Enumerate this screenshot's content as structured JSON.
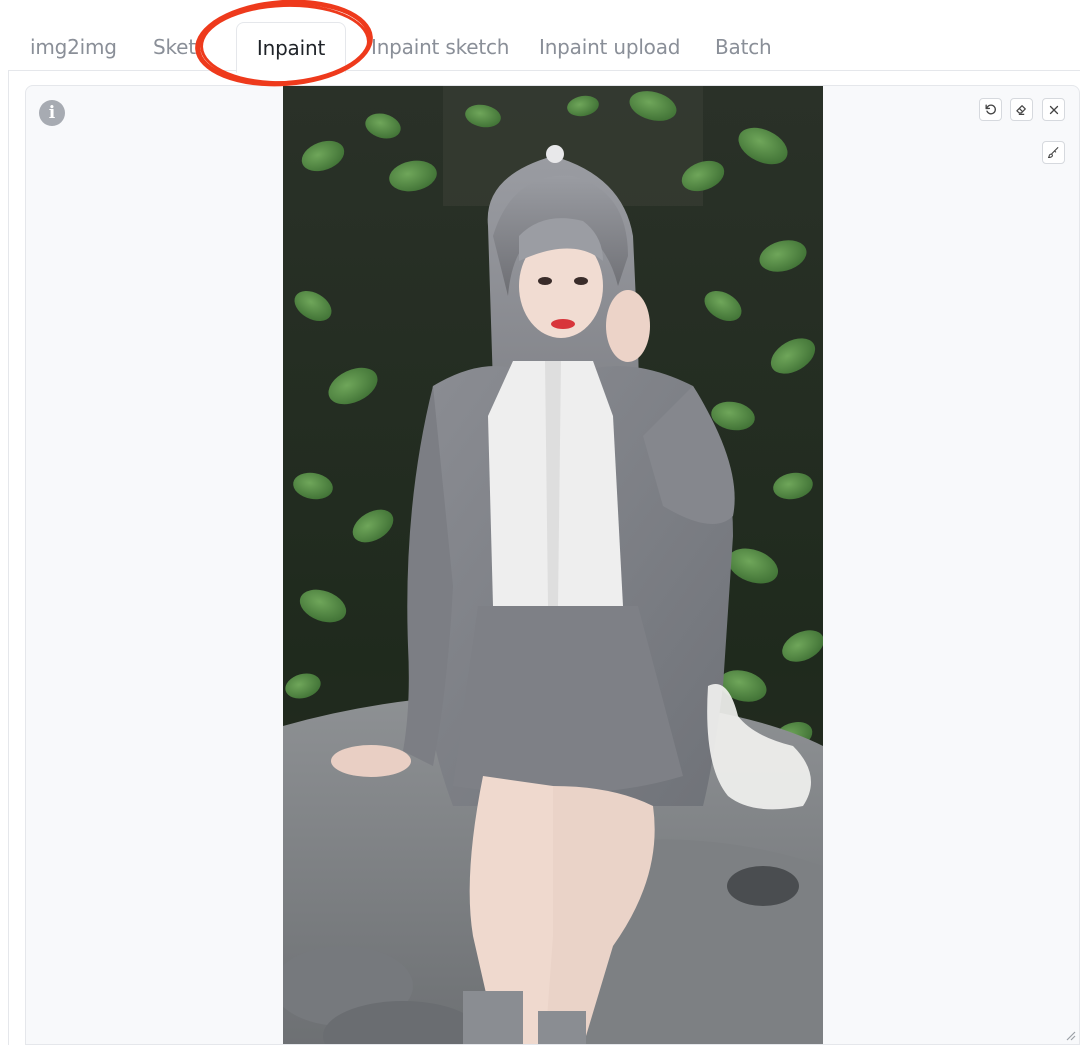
{
  "tabs": [
    {
      "label": "img2img",
      "active": false
    },
    {
      "label": "Sketch",
      "active": false
    },
    {
      "label": "Inpaint",
      "active": true
    },
    {
      "label": "Inpaint sketch",
      "active": false
    },
    {
      "label": "Inpaint upload",
      "active": false
    },
    {
      "label": "Batch",
      "active": false
    }
  ],
  "toolbar": {
    "icons": [
      "undo-icon",
      "eraser-icon",
      "close-icon",
      "brush-icon"
    ]
  },
  "panel": {
    "info_icon": "info-icon",
    "info_glyph": "i"
  },
  "annotation": {
    "highlight_color": "#ee3a1c",
    "highlighted_tab": "Inpaint"
  },
  "colors": {
    "tab_inactive": "#8a8f98",
    "tab_active": "#1f2328",
    "panel_bg": "#f8f9fb",
    "border": "#e5e7eb"
  }
}
